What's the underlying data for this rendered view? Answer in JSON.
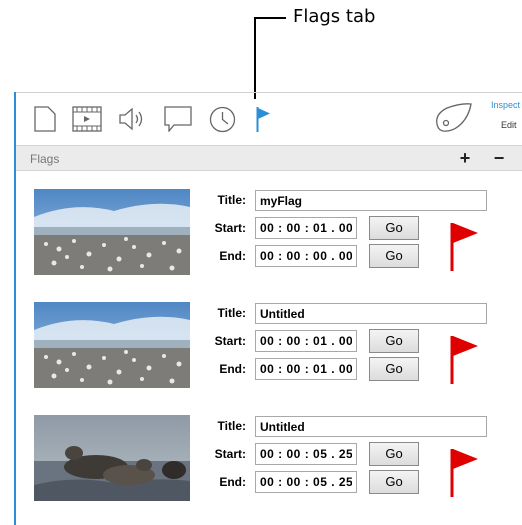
{
  "callout": {
    "label": "Flags tab"
  },
  "toolbar": {
    "inspect_label": "Inspect",
    "edit_label": "Edit",
    "tabs": [
      "document-icon",
      "film-icon",
      "audio-icon",
      "comment-icon",
      "clock-icon",
      "flag-tab-icon"
    ],
    "active_color": "#2b8fd8"
  },
  "flags_panel": {
    "title": "Flags",
    "add_label": "+",
    "remove_label": "−"
  },
  "labels": {
    "title": "Title:",
    "start": "Start:",
    "end": "End:",
    "go": "Go"
  },
  "flags": [
    {
      "title": "myFlag",
      "start": "00 : 00 : 01 . 00",
      "end": "00 : 00 : 00 . 00",
      "thumbnail": "beach-birds",
      "flag_color": "#e00000"
    },
    {
      "title": "Untitled",
      "start": "00 : 00 : 01 . 00",
      "end": "00 : 00 : 01 . 00",
      "thumbnail": "beach-birds",
      "flag_color": "#e00000"
    },
    {
      "title": "Untitled",
      "start": "00 : 00 : 05 . 25",
      "end": "00 : 00 : 05 . 25",
      "thumbnail": "seals-on-rocks",
      "flag_color": "#e00000"
    }
  ]
}
